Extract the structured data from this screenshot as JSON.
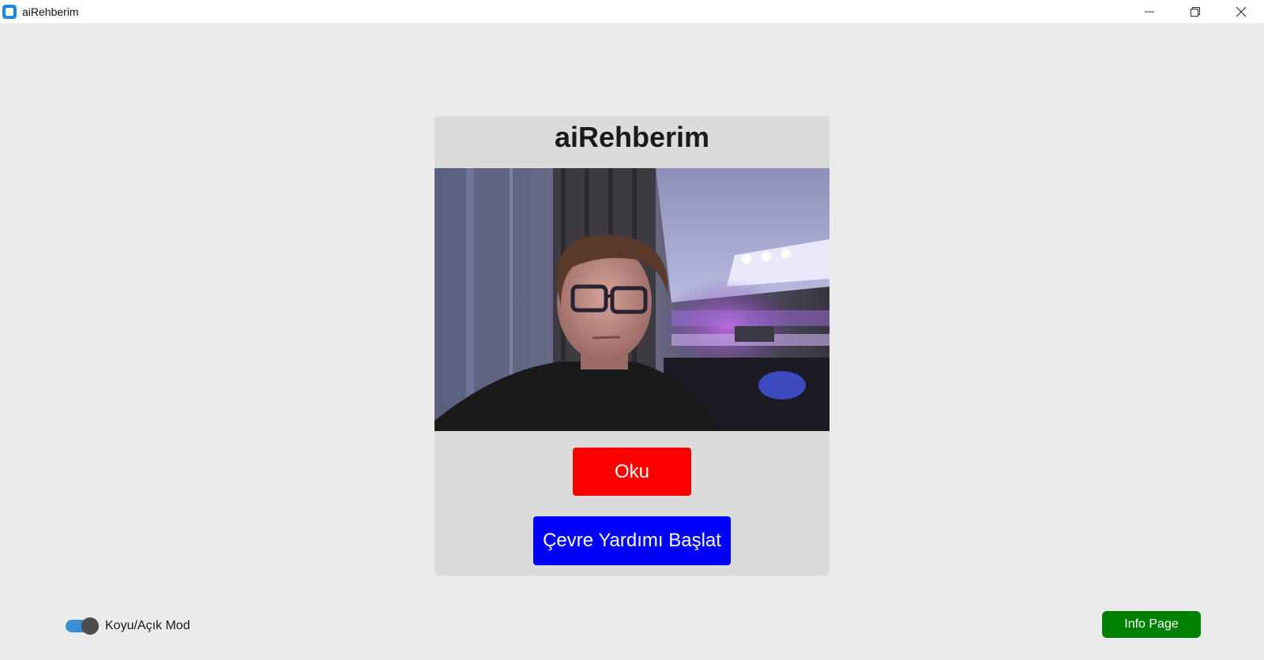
{
  "window": {
    "title": "aiRehberim",
    "controls": {
      "minimize_icon": "minimize-icon",
      "maximize_icon": "restore-icon",
      "close_icon": "close-icon"
    }
  },
  "card": {
    "title": "aiRehberim",
    "camera_feed": "camera-feed",
    "read_button": "Oku",
    "environment_button": "Çevre Yardımı Başlat"
  },
  "theme_toggle": {
    "label": "Koyu/Açık Mod",
    "state": "on"
  },
  "info_button": "Info Page",
  "colors": {
    "background": "#ebebeb",
    "card": "#dbdbdb",
    "read_button": "#ff0000",
    "environment_button": "#0000ff",
    "info_button": "#008000",
    "toggle_track": "#3b8ed0",
    "toggle_knob": "#4d4d4d"
  }
}
